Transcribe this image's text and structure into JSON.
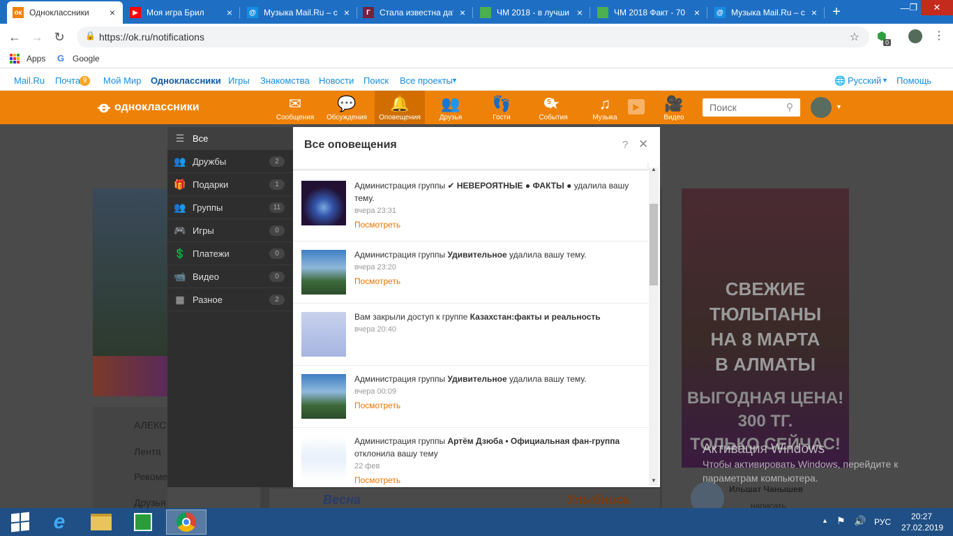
{
  "browser": {
    "tabs": [
      {
        "title": "Одноклассники",
        "fav_color": "#ee8208",
        "fav_text": "ок"
      },
      {
        "title": "Моя игра Брил",
        "fav_color": "#ff0000",
        "fav_text": "▶"
      },
      {
        "title": "Музыка Mail.Ru – с",
        "fav_color": "#168de2",
        "fav_text": "@"
      },
      {
        "title": "Стала известна дат",
        "fav_color": "#7a1f3d",
        "fav_text": "Г"
      },
      {
        "title": "ЧМ 2018 - в лучши",
        "fav_color": "#4caf50",
        "fav_text": ""
      },
      {
        "title": "ЧМ 2018 Факт - 70",
        "fav_color": "#4caf50",
        "fav_text": ""
      },
      {
        "title": "Музыка Mail.Ru – с",
        "fav_color": "#168de2",
        "fav_text": "@"
      }
    ],
    "new_tab": "+",
    "url": "https://ok.ru/notifications",
    "bookmarks": {
      "apps": "Apps",
      "google": "Google"
    },
    "ext_badge": "0"
  },
  "mailbar": {
    "links": [
      "Mail.Ru",
      "Почта",
      "Мой Мир",
      "Одноклассники",
      "Игры",
      "Знакомства",
      "Новости",
      "Поиск",
      "Все проекты"
    ],
    "mail_count": "9",
    "language": "Русский",
    "help": "Помощь"
  },
  "ok": {
    "logo": "одноклассники",
    "nav": [
      {
        "label": "Сообщения",
        "icon": "✉"
      },
      {
        "label": "Обсуждения",
        "icon": "💬"
      },
      {
        "label": "Оповещения",
        "icon": "🔔"
      },
      {
        "label": "Друзья",
        "icon": "👥"
      },
      {
        "label": "Гости",
        "icon": "👣"
      },
      {
        "label": "События",
        "icon": "★"
      },
      {
        "label": "Музыка",
        "icon": "♫"
      },
      {
        "label": "Видео",
        "icon": "🎥"
      }
    ],
    "events_badge": "5",
    "search_placeholder": "Поиск"
  },
  "sidebar": [
    {
      "label": "Все",
      "count": ""
    },
    {
      "label": "Дружбы",
      "count": "2"
    },
    {
      "label": "Подарки",
      "count": "1"
    },
    {
      "label": "Группы",
      "count": "11"
    },
    {
      "label": "Игры",
      "count": "0"
    },
    {
      "label": "Платежи",
      "count": "0"
    },
    {
      "label": "Видео",
      "count": "0"
    },
    {
      "label": "Разное",
      "count": "2"
    }
  ],
  "panel": {
    "title": "Все оповещения",
    "help": "?",
    "close": "✕",
    "items": [
      {
        "pre": "Администрация группы ",
        "bold": "✔ НЕВЕРОЯТНЫЕ ● ФАКТЫ ●",
        "post": " удалила вашу тему.",
        "time": "вчера 23:31",
        "link": "Посмотреть"
      },
      {
        "pre": "Администрация группы ",
        "bold": "Удивительное",
        "post": " удалила вашу тему.",
        "time": "вчера 23:20",
        "link": "Посмотреть"
      },
      {
        "pre": "Вам закрыли доступ к группе ",
        "bold": "Казахстан:факты и реальность",
        "post": "",
        "time": "вчера 20:40",
        "link": ""
      },
      {
        "pre": "Администрация группы ",
        "bold": "Удивительное",
        "post": " удалила вашу тему.",
        "time": "вчера 00:09",
        "link": "Посмотреть"
      },
      {
        "pre": "Администрация группы ",
        "bold": "Артём Дзюба • Официальная фан-группа",
        "post": " отклонила вашу тему",
        "time": "22 фев",
        "link": "Посмотреть"
      }
    ]
  },
  "background": {
    "profile_name": "АЛЕКС",
    "left_menu": [
      "Лента",
      "Рекоме",
      "Друзья"
    ],
    "ad_lines": [
      "СВЕЖИЕ",
      "ТЮЛЬПАНЫ",
      "НА 8 МАРТА",
      "В АЛМАТЫ"
    ],
    "ad_price": [
      "ВЫГОДНАЯ ЦЕНА!",
      "300 ТГ.",
      "ТОЛЬКО СЕЙЧАС!"
    ],
    "friend_name": "Ильшат Чанышев",
    "friend_action": "написать",
    "strip_text_1": "Весна",
    "strip_text_2": "Улыбнись"
  },
  "watermark": {
    "title": "Активация Windows",
    "line1": "Чтобы активировать Windows, перейдите к",
    "line2": "параметрам компьютера."
  },
  "taskbar": {
    "lang": "РУС",
    "time": "20:27",
    "date": "27.02.2019"
  }
}
